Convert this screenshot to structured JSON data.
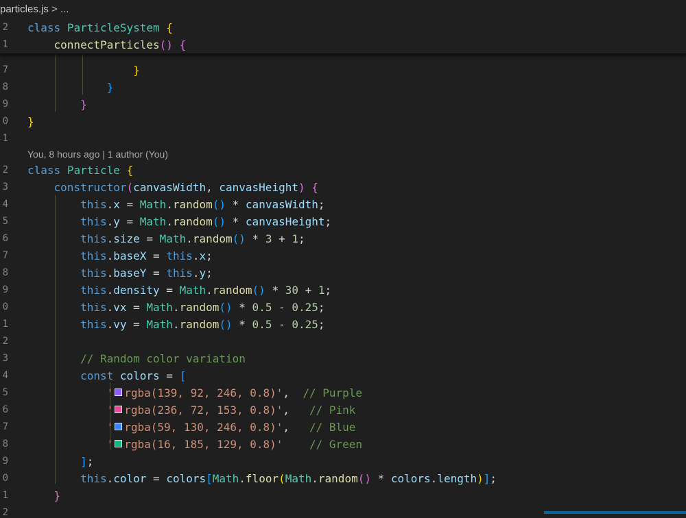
{
  "breadcrumb": {
    "file": "particles.js",
    "separator": ">",
    "more": "..."
  },
  "sticky": [
    {
      "num": "2",
      "tokens": [
        {
          "t": "class",
          "c": "kw"
        },
        {
          "t": " "
        },
        {
          "t": "ParticleSystem",
          "c": "cls"
        },
        {
          "t": " "
        },
        {
          "t": "{",
          "c": "b1"
        }
      ]
    },
    {
      "num": "1",
      "tokens": [
        {
          "t": "    "
        },
        {
          "t": "connectParticles",
          "c": "fn"
        },
        {
          "t": "()",
          "c": "b2"
        },
        {
          "t": " "
        },
        {
          "t": "{",
          "c": "b2"
        }
      ]
    }
  ],
  "blame": {
    "text": "You, 8 hours ago | 1 author (You)"
  },
  "upper_lines": [
    {
      "num": "7",
      "tokens": [
        {
          "t": "                "
        },
        {
          "t": "}",
          "c": "b1"
        }
      ]
    },
    {
      "num": "8",
      "tokens": [
        {
          "t": "            "
        },
        {
          "t": "}",
          "c": "b3"
        }
      ]
    },
    {
      "num": "9",
      "tokens": [
        {
          "t": "        "
        },
        {
          "t": "}",
          "c": "b2"
        }
      ]
    },
    {
      "num": "0",
      "tokens": [
        {
          "t": "}",
          "c": "b1"
        }
      ]
    },
    {
      "num": "1",
      "tokens": []
    }
  ],
  "lower_lines": [
    {
      "num": "2",
      "tokens": [
        {
          "t": "class",
          "c": "kw"
        },
        {
          "t": " "
        },
        {
          "t": "Particle",
          "c": "cls"
        },
        {
          "t": " "
        },
        {
          "t": "{",
          "c": "b1"
        }
      ]
    },
    {
      "num": "3",
      "tokens": [
        {
          "t": "    "
        },
        {
          "t": "constructor",
          "c": "kw"
        },
        {
          "t": "(",
          "c": "b2"
        },
        {
          "t": "canvasWidth",
          "c": "var"
        },
        {
          "t": ", "
        },
        {
          "t": "canvasHeight",
          "c": "var"
        },
        {
          "t": ")",
          "c": "b2"
        },
        {
          "t": " "
        },
        {
          "t": "{",
          "c": "b2"
        }
      ]
    },
    {
      "num": "4",
      "tokens": [
        {
          "t": "        "
        },
        {
          "t": "this",
          "c": "kw"
        },
        {
          "t": "."
        },
        {
          "t": "x",
          "c": "var"
        },
        {
          "t": " = "
        },
        {
          "t": "Math",
          "c": "cls"
        },
        {
          "t": "."
        },
        {
          "t": "random",
          "c": "fn"
        },
        {
          "t": "()",
          "c": "b3"
        },
        {
          "t": " * "
        },
        {
          "t": "canvasWidth",
          "c": "var"
        },
        {
          "t": ";"
        }
      ]
    },
    {
      "num": "5",
      "tokens": [
        {
          "t": "        "
        },
        {
          "t": "this",
          "c": "kw"
        },
        {
          "t": "."
        },
        {
          "t": "y",
          "c": "var"
        },
        {
          "t": " = "
        },
        {
          "t": "Math",
          "c": "cls"
        },
        {
          "t": "."
        },
        {
          "t": "random",
          "c": "fn"
        },
        {
          "t": "()",
          "c": "b3"
        },
        {
          "t": " * "
        },
        {
          "t": "canvasHeight",
          "c": "var"
        },
        {
          "t": ";"
        }
      ]
    },
    {
      "num": "6",
      "tokens": [
        {
          "t": "        "
        },
        {
          "t": "this",
          "c": "kw"
        },
        {
          "t": "."
        },
        {
          "t": "size",
          "c": "var"
        },
        {
          "t": " = "
        },
        {
          "t": "Math",
          "c": "cls"
        },
        {
          "t": "."
        },
        {
          "t": "random",
          "c": "fn"
        },
        {
          "t": "()",
          "c": "b3"
        },
        {
          "t": " * "
        },
        {
          "t": "3",
          "c": "num"
        },
        {
          "t": " + "
        },
        {
          "t": "1",
          "c": "num"
        },
        {
          "t": ";"
        }
      ]
    },
    {
      "num": "7",
      "tokens": [
        {
          "t": "        "
        },
        {
          "t": "this",
          "c": "kw"
        },
        {
          "t": "."
        },
        {
          "t": "baseX",
          "c": "var"
        },
        {
          "t": " = "
        },
        {
          "t": "this",
          "c": "kw"
        },
        {
          "t": "."
        },
        {
          "t": "x",
          "c": "var"
        },
        {
          "t": ";"
        }
      ]
    },
    {
      "num": "8",
      "tokens": [
        {
          "t": "        "
        },
        {
          "t": "this",
          "c": "kw"
        },
        {
          "t": "."
        },
        {
          "t": "baseY",
          "c": "var"
        },
        {
          "t": " = "
        },
        {
          "t": "this",
          "c": "kw"
        },
        {
          "t": "."
        },
        {
          "t": "y",
          "c": "var"
        },
        {
          "t": ";"
        }
      ]
    },
    {
      "num": "9",
      "tokens": [
        {
          "t": "        "
        },
        {
          "t": "this",
          "c": "kw"
        },
        {
          "t": "."
        },
        {
          "t": "density",
          "c": "var"
        },
        {
          "t": " = "
        },
        {
          "t": "Math",
          "c": "cls"
        },
        {
          "t": "."
        },
        {
          "t": "random",
          "c": "fn"
        },
        {
          "t": "()",
          "c": "b3"
        },
        {
          "t": " * "
        },
        {
          "t": "30",
          "c": "num"
        },
        {
          "t": " + "
        },
        {
          "t": "1",
          "c": "num"
        },
        {
          "t": ";"
        }
      ]
    },
    {
      "num": "0",
      "tokens": [
        {
          "t": "        "
        },
        {
          "t": "this",
          "c": "kw"
        },
        {
          "t": "."
        },
        {
          "t": "vx",
          "c": "var"
        },
        {
          "t": " = "
        },
        {
          "t": "Math",
          "c": "cls"
        },
        {
          "t": "."
        },
        {
          "t": "random",
          "c": "fn"
        },
        {
          "t": "()",
          "c": "b3"
        },
        {
          "t": " * "
        },
        {
          "t": "0.5",
          "c": "num"
        },
        {
          "t": " - "
        },
        {
          "t": "0.25",
          "c": "num"
        },
        {
          "t": ";"
        }
      ]
    },
    {
      "num": "1",
      "tokens": [
        {
          "t": "        "
        },
        {
          "t": "this",
          "c": "kw"
        },
        {
          "t": "."
        },
        {
          "t": "vy",
          "c": "var"
        },
        {
          "t": " = "
        },
        {
          "t": "Math",
          "c": "cls"
        },
        {
          "t": "."
        },
        {
          "t": "random",
          "c": "fn"
        },
        {
          "t": "()",
          "c": "b3"
        },
        {
          "t": " * "
        },
        {
          "t": "0.5",
          "c": "num"
        },
        {
          "t": " - "
        },
        {
          "t": "0.25",
          "c": "num"
        },
        {
          "t": ";"
        }
      ]
    },
    {
      "num": "2",
      "tokens": []
    },
    {
      "num": "3",
      "tokens": [
        {
          "t": "        "
        },
        {
          "t": "// Random color variation",
          "c": "cmt"
        }
      ]
    },
    {
      "num": "4",
      "tokens": [
        {
          "t": "        "
        },
        {
          "t": "const",
          "c": "kw"
        },
        {
          "t": " "
        },
        {
          "t": "colors",
          "c": "var"
        },
        {
          "t": " = "
        },
        {
          "t": "[",
          "c": "b3"
        }
      ]
    },
    {
      "num": "5",
      "tokens": [
        {
          "t": "            "
        },
        {
          "t": "'",
          "c": "str"
        },
        {
          "sw": "#8b5cf6"
        },
        {
          "t": "rgba(139, 92, 246, 0.8)'",
          "c": "str"
        },
        {
          "t": ",  "
        },
        {
          "t": "// Purple",
          "c": "cmt"
        }
      ]
    },
    {
      "num": "6",
      "tokens": [
        {
          "t": "            "
        },
        {
          "t": "'",
          "c": "str"
        },
        {
          "sw": "#ec4899"
        },
        {
          "t": "rgba(236, 72, 153, 0.8)'",
          "c": "str"
        },
        {
          "t": ",   "
        },
        {
          "t": "// Pink",
          "c": "cmt"
        }
      ]
    },
    {
      "num": "7",
      "tokens": [
        {
          "t": "            "
        },
        {
          "t": "'",
          "c": "str"
        },
        {
          "sw": "#3b82f6"
        },
        {
          "t": "rgba(59, 130, 246, 0.8)'",
          "c": "str"
        },
        {
          "t": ",   "
        },
        {
          "t": "// Blue",
          "c": "cmt"
        }
      ]
    },
    {
      "num": "8",
      "tokens": [
        {
          "t": "            "
        },
        {
          "t": "'",
          "c": "str"
        },
        {
          "sw": "#10b981"
        },
        {
          "t": "rgba(16, 185, 129, 0.8)'",
          "c": "str"
        },
        {
          "t": "    "
        },
        {
          "t": "// Green",
          "c": "cmt"
        }
      ]
    },
    {
      "num": "9",
      "tokens": [
        {
          "t": "        "
        },
        {
          "t": "]",
          "c": "b3"
        },
        {
          "t": ";"
        }
      ]
    },
    {
      "num": "0",
      "tokens": [
        {
          "t": "        "
        },
        {
          "t": "this",
          "c": "kw"
        },
        {
          "t": "."
        },
        {
          "t": "color",
          "c": "var"
        },
        {
          "t": " = "
        },
        {
          "t": "colors",
          "c": "var"
        },
        {
          "t": "[",
          "c": "b3"
        },
        {
          "t": "Math",
          "c": "cls"
        },
        {
          "t": "."
        },
        {
          "t": "floor",
          "c": "fn"
        },
        {
          "t": "(",
          "c": "b1"
        },
        {
          "t": "Math",
          "c": "cls"
        },
        {
          "t": "."
        },
        {
          "t": "random",
          "c": "fn"
        },
        {
          "t": "()",
          "c": "b2"
        },
        {
          "t": " * "
        },
        {
          "t": "colors",
          "c": "var"
        },
        {
          "t": "."
        },
        {
          "t": "length",
          "c": "var"
        },
        {
          "t": ")",
          "c": "b1"
        },
        {
          "t": "]",
          "c": "b3"
        },
        {
          "t": ";"
        }
      ]
    },
    {
      "num": "1",
      "tokens": [
        {
          "t": "    "
        },
        {
          "t": "}",
          "c": "b2"
        }
      ]
    },
    {
      "num": "2",
      "tokens": []
    }
  ],
  "colors": {
    "editor_bg": "#1f1f1f",
    "highlight_bg": "#373d29",
    "swatches": [
      "#8b5cf6",
      "#ec4899",
      "#3b82f6",
      "#10b981"
    ]
  }
}
